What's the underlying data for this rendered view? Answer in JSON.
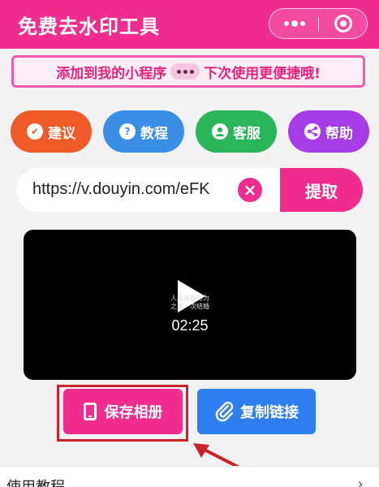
{
  "header": {
    "title": "免费去水印工具"
  },
  "banner": {
    "text_before": "添加到我的小程序",
    "text_after": "下次使用更便捷哦!"
  },
  "action_buttons": {
    "suggest": "建议",
    "tutorial": "教程",
    "service": "客服",
    "help": "帮助"
  },
  "url_input": {
    "value": "https://v.douyin.com/eFK",
    "clear_icon": "close-icon"
  },
  "extract_button": "提取",
  "video": {
    "caption_line1": "人类迷惑行为",
    "caption_line2": "之第一次结婚",
    "duration": "02:25"
  },
  "save_button": "保存相册",
  "copy_button": "复制链接",
  "list": {
    "tutorial_row": "使用教程",
    "chevron": "›"
  },
  "colors": {
    "brand_pink": "#f02c8f",
    "suggest_orange": "#f05a28",
    "tutorial_blue": "#3b8ee6",
    "service_green": "#2bb55a",
    "help_purple": "#a63ce6",
    "copy_blue": "#2f7ef0",
    "annotation_red": "#c8232c"
  }
}
